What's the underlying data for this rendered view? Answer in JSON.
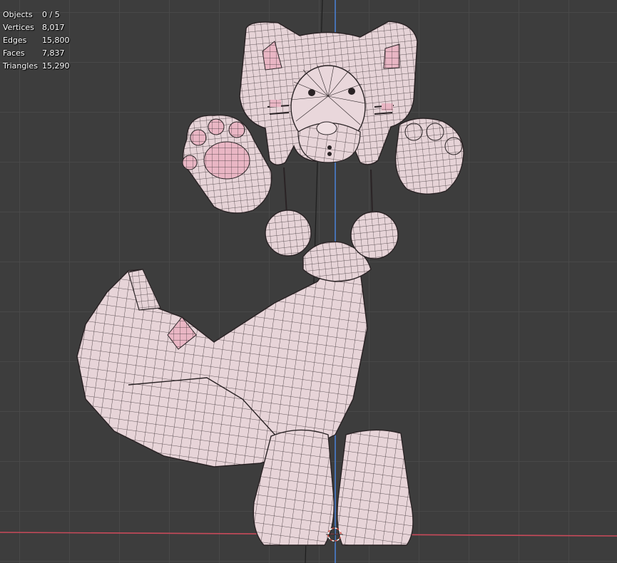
{
  "stats": [
    {
      "label": "Objects",
      "value": "0 / 5"
    },
    {
      "label": "Vertices",
      "value": "8,017"
    },
    {
      "label": "Edges",
      "value": "15,800"
    },
    {
      "label": "Faces",
      "value": "7,837"
    },
    {
      "label": "Triangles",
      "value": "15,290"
    }
  ],
  "colors": {
    "background": "#3d3d3d",
    "grid": "#4a4a4a",
    "x_axis": "#c84a5a",
    "z_axis": "#4a7fd0",
    "mesh_fill": "#e6d2d6",
    "mesh_accent": "#e8b3c2",
    "wire": "#2a2325"
  },
  "icons": [
    "3d-cursor-icon"
  ]
}
